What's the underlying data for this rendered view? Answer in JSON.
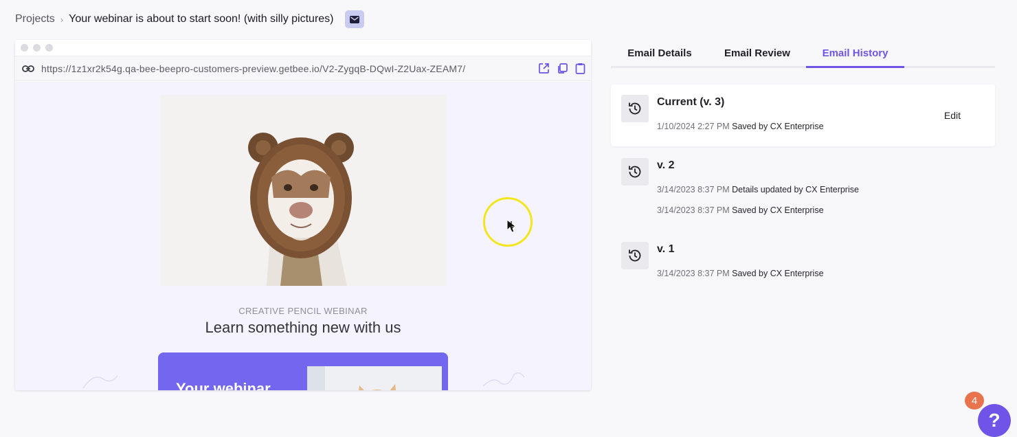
{
  "breadcrumb": {
    "root": "Projects",
    "separator": "›",
    "current": "Your webinar is about to start soon! (with silly pictures)",
    "icon": "mail-icon"
  },
  "preview": {
    "url": "https://1z1xr2k54g.qa-bee-beepro-customers-preview.getbee.io/V2-ZygqB-DQwI-Z2Uax-ZEAM7/",
    "actions": [
      "external-link-icon",
      "copy-icon",
      "clipboard-icon"
    ],
    "email": {
      "eyebrow": "CREATIVE PENCIL WEBINAR",
      "headline": "Learn something new with us",
      "promo_text": "Your webinar",
      "hero_image": "dog-in-bear-hat"
    }
  },
  "tabs": [
    {
      "label": "Email Details",
      "active": false
    },
    {
      "label": "Email Review",
      "active": false
    },
    {
      "label": "Email History",
      "active": true
    }
  ],
  "history": [
    {
      "title": "Current (v. 3)",
      "entries": [
        {
          "time": "1/10/2024 2:27 PM",
          "text": "Saved by CX Enterprise"
        }
      ],
      "action": "Edit"
    },
    {
      "title": "v. 2",
      "entries": [
        {
          "time": "3/14/2023 8:37 PM",
          "text": "Details updated by CX Enterprise"
        },
        {
          "time": "3/14/2023 8:37 PM",
          "text": "Saved by CX Enterprise"
        }
      ]
    },
    {
      "title": "v. 1",
      "entries": [
        {
          "time": "3/14/2023 8:37 PM",
          "text": "Saved by CX Enterprise"
        }
      ]
    }
  ],
  "help": {
    "badge_count": "4",
    "label": "?"
  },
  "colors": {
    "accent": "#7054e8",
    "promo": "#7367f0",
    "badge": "#e8734d",
    "cursor_ring": "#f2e61c"
  }
}
